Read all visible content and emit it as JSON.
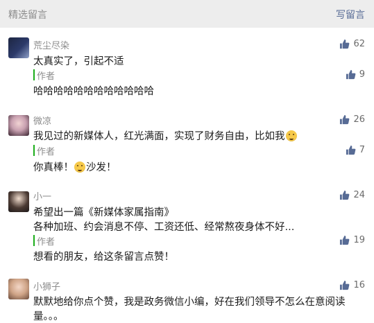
{
  "header": {
    "title": "精选留言",
    "write_label": "写留言"
  },
  "comments": [
    {
      "nickname": "荒尘尽染",
      "content": "太真实了，引起不适",
      "likes": "62",
      "reply": {
        "author": "作者",
        "content": "哈哈哈哈哈哈哈哈哈哈哈哈",
        "likes": "9"
      }
    },
    {
      "nickname": "微凉",
      "content": "我见过的新媒体人，红光满面，实现了财务自由，比如我",
      "likes": "26",
      "reply": {
        "author": "作者",
        "content_pre": "你真棒！",
        "content_post": "沙发！",
        "likes": "7"
      }
    },
    {
      "nickname": "小一",
      "content_line1": "希望出一篇《新媒体家属指南》",
      "content_line2": "各种加班、约会消息不停、工资还低、经常熬夜身体不好...",
      "likes": "24",
      "reply": {
        "author": "作者",
        "content": "想看的朋友，给这条留言点赞！",
        "likes": "19"
      }
    },
    {
      "nickname": "小狮子",
      "content_line1": "默默地给你点个赞，我是政务微信小编，好在我们领导不怎么在意阅读",
      "content_line2": "量。。。",
      "likes": "16"
    }
  ],
  "colors": {
    "accent_link": "#576b95",
    "author_bar": "#1aad19",
    "like_icon": "#576b95"
  }
}
